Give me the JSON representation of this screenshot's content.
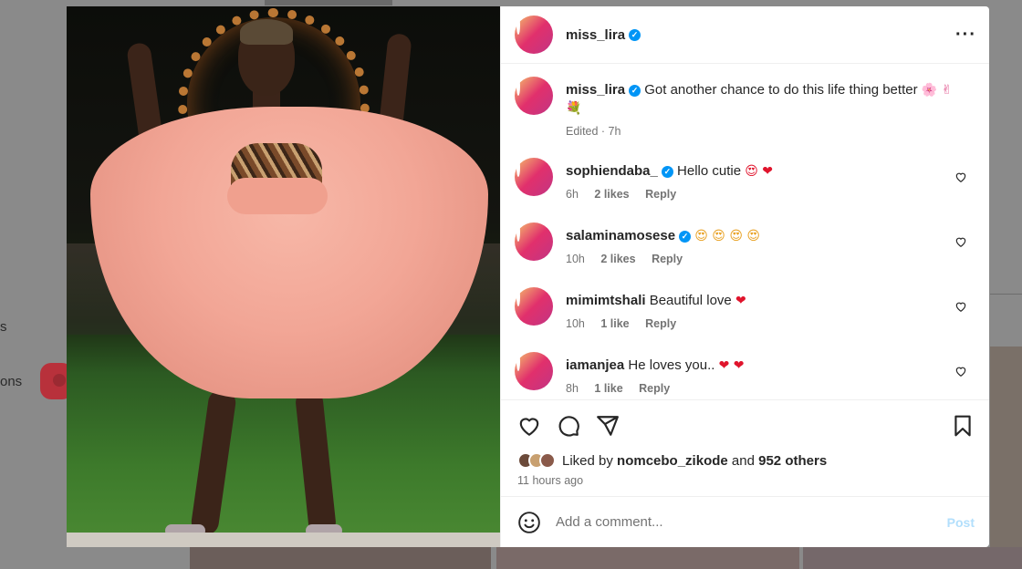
{
  "background": {
    "side_text_1": "s",
    "side_text_2": "ons"
  },
  "post": {
    "author": "miss_lira",
    "more_icon": "more-horizontal-icon",
    "caption": {
      "username": "miss_lira",
      "text": "Got another chance to do this life thing better",
      "emojis": "🌸 ✌",
      "emoji_line2": "💐",
      "edited": "Edited · 7h"
    },
    "comments": [
      {
        "username": "sophiendaba_",
        "verified": true,
        "text": "Hello cutie",
        "emoji": "😍 ❤",
        "time": "6h",
        "likes": "2 likes",
        "reply": "Reply",
        "avatar": "av-sophie"
      },
      {
        "username": "salaminamosese",
        "verified": true,
        "text": "",
        "emoji": "😍 😍 😍 😍",
        "time": "10h",
        "likes": "2 likes",
        "reply": "Reply",
        "avatar": "av-salamina"
      },
      {
        "username": "mimimtshali",
        "verified": false,
        "text": "Beautiful love",
        "emoji": "❤",
        "time": "10h",
        "likes": "1 like",
        "reply": "Reply",
        "avatar": "av-mimi"
      },
      {
        "username": "iamanjea",
        "verified": false,
        "text": "He loves you..",
        "emoji": "❤ ❤",
        "time": "8h",
        "likes": "1 like",
        "reply": "Reply",
        "avatar": "av-iamanjea"
      }
    ],
    "likes": {
      "prefix": "Liked by",
      "user": "nomcebo_zikode",
      "joiner": "and",
      "others": "952 others"
    },
    "time_ago": "11 hours ago",
    "add_comment": {
      "placeholder": "Add a comment...",
      "post_label": "Post"
    },
    "colors": {
      "verified": "#0095f6",
      "heart_red": "#e0142c",
      "post_disabled": "#b2dffc",
      "muted": "#737373"
    }
  }
}
